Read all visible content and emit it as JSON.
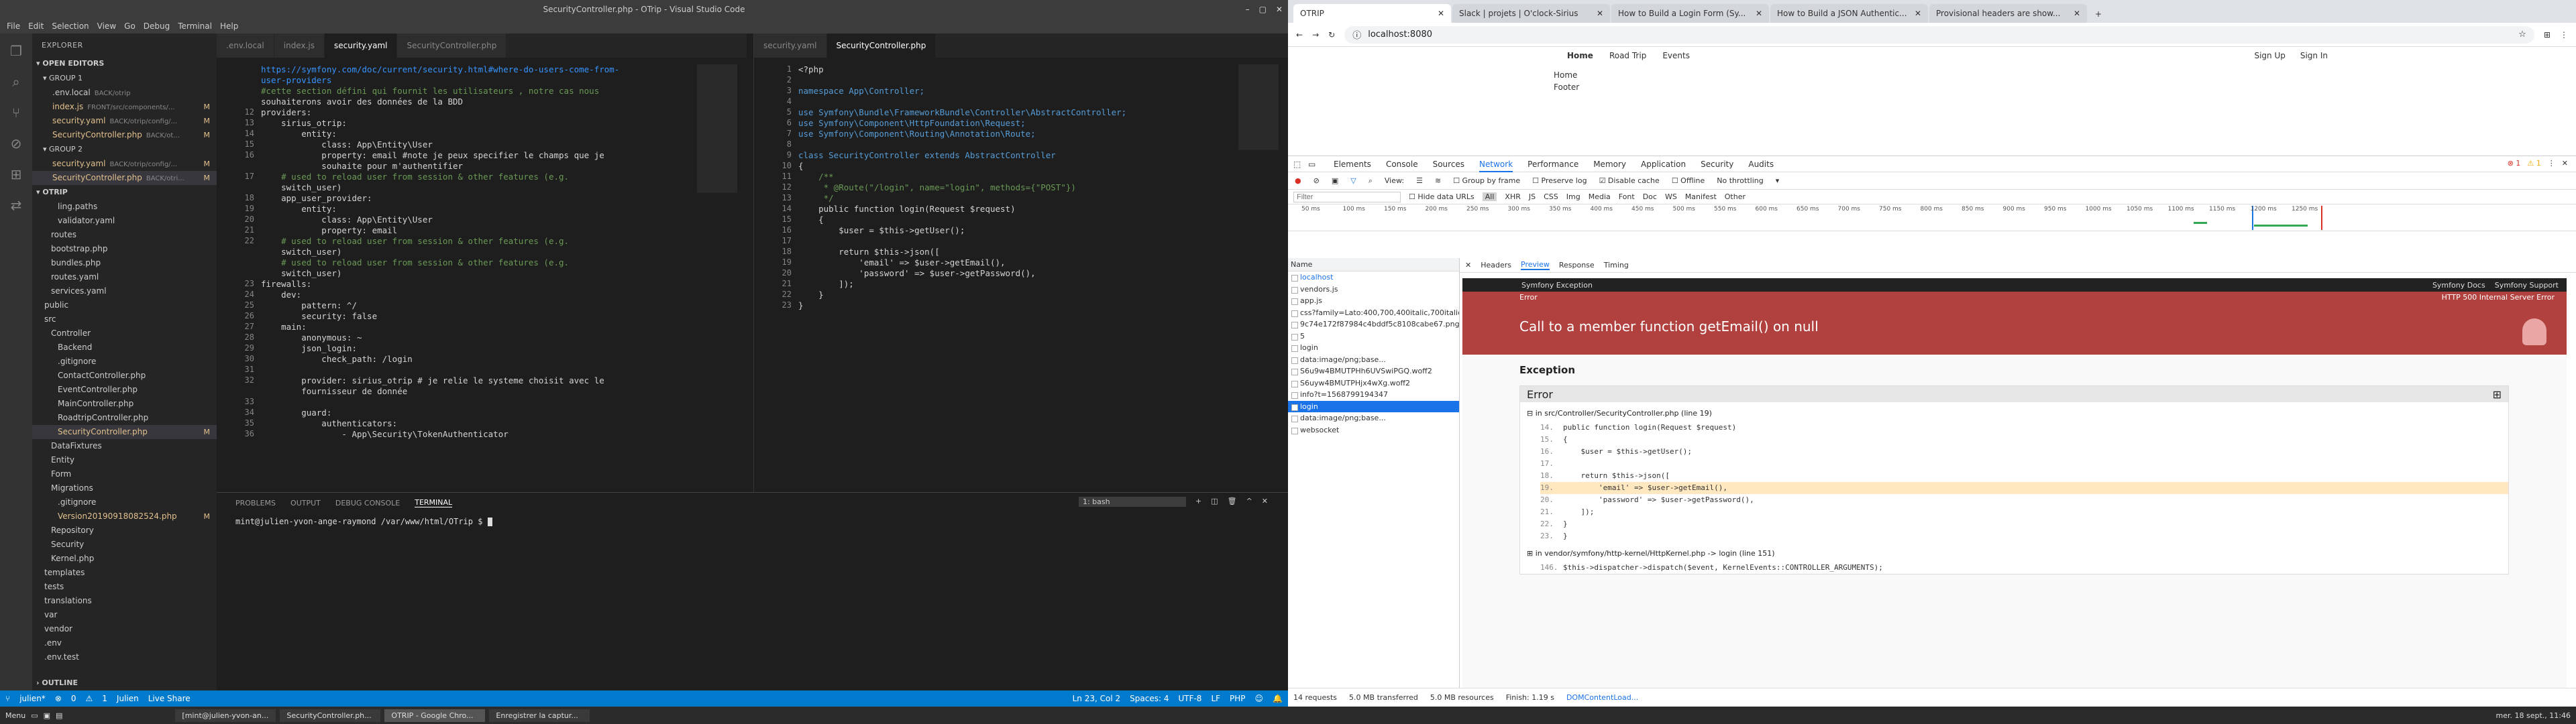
{
  "vscode": {
    "title": "SecurityController.php - OTrip - Visual Studio Code",
    "menu": [
      "File",
      "Edit",
      "Selection",
      "View",
      "Go",
      "Debug",
      "Terminal",
      "Help"
    ],
    "explorer_header": "EXPLORER",
    "open_editors": "OPEN EDITORS",
    "group1": "GROUP 1",
    "group1_items": [
      {
        "name": ".env.local",
        "desc": "BACK/otrip",
        "badge": ""
      },
      {
        "name": "index.js",
        "desc": "FRONT/src/components/...",
        "badge": "M"
      },
      {
        "name": "security.yaml",
        "desc": "BACK/otrip/config/...",
        "badge": "M"
      },
      {
        "name": "SecurityController.php",
        "desc": "BACK/ot...",
        "badge": "M"
      }
    ],
    "group2": "GROUP 2",
    "group2_items": [
      {
        "name": "security.yaml",
        "desc": "BACK/otrip/config/...",
        "badge": "M"
      },
      {
        "name": "SecurityController.php",
        "desc": "BACK/otri...",
        "badge": "M"
      }
    ],
    "project": "OTRIP",
    "tree": [
      {
        "label": "ling.paths",
        "indent": 3,
        "badge": ""
      },
      {
        "label": "validator.yaml",
        "indent": 3,
        "badge": ""
      },
      {
        "label": "routes",
        "indent": 2,
        "badge": ""
      },
      {
        "label": "bootstrap.php",
        "indent": 2,
        "badge": ""
      },
      {
        "label": "bundles.php",
        "indent": 2,
        "badge": ""
      },
      {
        "label": "routes.yaml",
        "indent": 2,
        "badge": ""
      },
      {
        "label": "services.yaml",
        "indent": 2,
        "badge": ""
      },
      {
        "label": "public",
        "indent": 1,
        "badge": ""
      },
      {
        "label": "src",
        "indent": 1,
        "badge": ""
      },
      {
        "label": "Controller",
        "indent": 2,
        "badge": ""
      },
      {
        "label": "Backend",
        "indent": 3,
        "badge": ""
      },
      {
        "label": ".gitignore",
        "indent": 3,
        "badge": ""
      },
      {
        "label": "ContactController.php",
        "indent": 3,
        "badge": ""
      },
      {
        "label": "EventController.php",
        "indent": 3,
        "badge": ""
      },
      {
        "label": "MainController.php",
        "indent": 3,
        "badge": ""
      },
      {
        "label": "RoadtripController.php",
        "indent": 3,
        "badge": ""
      },
      {
        "label": "SecurityController.php",
        "indent": 3,
        "badge": "M"
      },
      {
        "label": "DataFixtures",
        "indent": 2,
        "badge": ""
      },
      {
        "label": "Entity",
        "indent": 2,
        "badge": ""
      },
      {
        "label": "Form",
        "indent": 2,
        "badge": ""
      },
      {
        "label": "Migrations",
        "indent": 2,
        "badge": ""
      },
      {
        "label": ".gitignore",
        "indent": 3,
        "badge": ""
      },
      {
        "label": "Version20190918082524.php",
        "indent": 3,
        "badge": "M"
      },
      {
        "label": "Repository",
        "indent": 2,
        "badge": ""
      },
      {
        "label": "Security",
        "indent": 2,
        "badge": ""
      },
      {
        "label": "Kernel.php",
        "indent": 2,
        "badge": ""
      },
      {
        "label": "templates",
        "indent": 1,
        "badge": ""
      },
      {
        "label": "tests",
        "indent": 1,
        "badge": ""
      },
      {
        "label": "translations",
        "indent": 1,
        "badge": ""
      },
      {
        "label": "var",
        "indent": 1,
        "badge": ""
      },
      {
        "label": "vendor",
        "indent": 1,
        "badge": ""
      },
      {
        "label": ".env",
        "indent": 1,
        "badge": ""
      },
      {
        "label": ".env.test",
        "indent": 1,
        "badge": ""
      }
    ],
    "outline": "OUTLINE",
    "left_tabs": [
      ".env.local",
      "index.js",
      "security.yaml",
      "SecurityController.php"
    ],
    "right_tabs": [
      "security.yaml",
      "SecurityController.php"
    ],
    "left_lines": [
      {
        "n": "",
        "t": "https://symfony.com/doc/current/security.html#where-do-users-come-from-"
      },
      {
        "n": "",
        "t": "user-providers"
      },
      {
        "n": "",
        "t": "#cette section défini qui fournit les utilisateurs , notre cas nous"
      },
      {
        "n": "",
        "t": "souhaiterons avoir des données de la BDD"
      },
      {
        "n": "12",
        "t": "providers:"
      },
      {
        "n": "13",
        "t": "    sirius_otrip:"
      },
      {
        "n": "14",
        "t": "        entity:"
      },
      {
        "n": "15",
        "t": "            class: App\\Entity\\User"
      },
      {
        "n": "16",
        "t": "            property: email #note je peux specifier le champs que je"
      },
      {
        "n": "",
        "t": "            souhaite pour m'authentifier"
      },
      {
        "n": "17",
        "t": "    # used to reload user from session & other features (e.g."
      },
      {
        "n": "",
        "t": "    switch_user)"
      },
      {
        "n": "18",
        "t": "    app_user_provider:"
      },
      {
        "n": "19",
        "t": "        entity:"
      },
      {
        "n": "20",
        "t": "            class: App\\Entity\\User"
      },
      {
        "n": "21",
        "t": "            property: email"
      },
      {
        "n": "22",
        "t": "    # used to reload user from session & other features (e.g."
      },
      {
        "n": "",
        "t": "    switch_user)"
      },
      {
        "n": "",
        "t": "    # used to reload user from session & other features (e.g."
      },
      {
        "n": "",
        "t": "    switch_user)"
      },
      {
        "n": "23",
        "t": "firewalls:"
      },
      {
        "n": "24",
        "t": "    dev:"
      },
      {
        "n": "25",
        "t": "        pattern: ^/"
      },
      {
        "n": "26",
        "t": "        security: false"
      },
      {
        "n": "27",
        "t": "    main:"
      },
      {
        "n": "28",
        "t": "        anonymous: ~"
      },
      {
        "n": "29",
        "t": "        json_login:"
      },
      {
        "n": "30",
        "t": "            check_path: /login"
      },
      {
        "n": "31",
        "t": ""
      },
      {
        "n": "32",
        "t": "        provider: sirius_otrip # je relie le systeme choisit avec le"
      },
      {
        "n": "",
        "t": "        fournisseur de donnée"
      },
      {
        "n": "33",
        "t": ""
      },
      {
        "n": "34",
        "t": "        guard:"
      },
      {
        "n": "35",
        "t": "            authenticators:"
      },
      {
        "n": "36",
        "t": "                - App\\Security\\TokenAuthenticator"
      }
    ],
    "right_lines": [
      {
        "n": "1",
        "t": "<?php"
      },
      {
        "n": "2",
        "t": ""
      },
      {
        "n": "3",
        "t": "namespace App\\Controller;"
      },
      {
        "n": "4",
        "t": ""
      },
      {
        "n": "5",
        "t": "use Symfony\\Bundle\\FrameworkBundle\\Controller\\AbstractController;"
      },
      {
        "n": "6",
        "t": "use Symfony\\Component\\HttpFoundation\\Request;"
      },
      {
        "n": "7",
        "t": "use Symfony\\Component\\Routing\\Annotation\\Route;"
      },
      {
        "n": "8",
        "t": ""
      },
      {
        "n": "9",
        "t": "class SecurityController extends AbstractController"
      },
      {
        "n": "10",
        "t": "{"
      },
      {
        "n": "11",
        "t": "    /**"
      },
      {
        "n": "12",
        "t": "     * @Route(\"/login\", name=\"login\", methods={\"POST\"})"
      },
      {
        "n": "13",
        "t": "     */"
      },
      {
        "n": "14",
        "t": "    public function login(Request $request)"
      },
      {
        "n": "15",
        "t": "    {"
      },
      {
        "n": "16",
        "t": "        $user = $this->getUser();"
      },
      {
        "n": "17",
        "t": ""
      },
      {
        "n": "18",
        "t": "        return $this->json(["
      },
      {
        "n": "19",
        "t": "            'email' => $user->getEmail(),"
      },
      {
        "n": "20",
        "t": "            'password' => $user->getPassword(),"
      },
      {
        "n": "21",
        "t": "        ]);"
      },
      {
        "n": "22",
        "t": "    }"
      },
      {
        "n": "23",
        "t": "}"
      }
    ],
    "panel_tabs": [
      "PROBLEMS",
      "OUTPUT",
      "DEBUG CONSOLE",
      "TERMINAL"
    ],
    "terminal_select": "1: bash",
    "terminal_prompt": "mint@julien-yvon-ange-raymond /var/www/html/OTrip $ ",
    "status_left": [
      "julien*",
      "0",
      "1",
      "Julien",
      "Live Share"
    ],
    "status_right": [
      "Ln 23, Col 2",
      "Spaces: 4",
      "UTF-8",
      "LF",
      "PHP"
    ]
  },
  "chrome": {
    "tabs": [
      "OTRIP",
      "Slack | projets | O'clock-Sirius",
      "How to Build a Login Form (Sy...",
      "How to Build a JSON Authentic...",
      "Provisional headers are show..."
    ],
    "url": "localhost:8080",
    "nav": [
      "Home",
      "Road Trip",
      "Events"
    ],
    "nav_right": [
      "Sign Up",
      "Sign In"
    ],
    "page_items": [
      "Home",
      "Footer"
    ],
    "devtools_tabs": [
      "Elements",
      "Console",
      "Sources",
      "Network",
      "Performance",
      "Memory",
      "Application",
      "Security",
      "Audits"
    ],
    "errors_badge": "1",
    "warnings_badge": "1",
    "toolbar": [
      "View:",
      "Group by frame",
      "Preserve log",
      "Disable cache",
      "Offline",
      "No throttling"
    ],
    "filter_placeholder": "Filter",
    "filter_types": [
      "Hide data URLs",
      "All",
      "XHR",
      "JS",
      "CSS",
      "Img",
      "Media",
      "Font",
      "Doc",
      "WS",
      "Manifest",
      "Other"
    ],
    "timeline_ticks": [
      "50 ms",
      "100 ms",
      "150 ms",
      "200 ms",
      "250 ms",
      "300 ms",
      "350 ms",
      "400 ms",
      "450 ms",
      "500 ms",
      "550 ms",
      "600 ms",
      "650 ms",
      "700 ms",
      "750 ms",
      "800 ms",
      "850 ms",
      "900 ms",
      "950 ms",
      "1000 ms",
      "1050 ms",
      "1100 ms",
      "1150 ms",
      "1200 ms",
      "1250 ms"
    ],
    "requests_header": "Name",
    "requests": [
      "localhost",
      "vendors.js",
      "app.js",
      "css?family=Lato:400,700,400italic,700italic&subset=latin",
      "9c74e172f87984c4bddf5c8108cabe67.png",
      "5",
      "login",
      "data:image/png;base...",
      "S6u9w4BMUTPHh6UVSwiPGQ.woff2",
      "S6uyw4BMUTPHjx4wXg.woff2",
      "info?t=1568799194347",
      "login",
      "data:image/png;base...",
      "websocket"
    ],
    "selected_request": 11,
    "preview_tabs": [
      "Headers",
      "Preview",
      "Response",
      "Timing"
    ],
    "sf_brand": "Symfony Exception",
    "sf_links": [
      "Symfony Docs",
      "Symfony Support"
    ],
    "sf_error_label": "Error",
    "sf_status": "HTTP 500 Internal Server Error",
    "sf_message": "Call to a member function getEmail() on null",
    "sf_exception": "Exception",
    "sf_error_title": "Error",
    "sf_trace1": "in src/Controller/SecurityController.php (line 19)",
    "sf_source": [
      {
        "n": "14.",
        "t": "public function login(Request $request)",
        "hl": false
      },
      {
        "n": "15.",
        "t": "{",
        "hl": false
      },
      {
        "n": "16.",
        "t": "    $user = $this->getUser();",
        "hl": false
      },
      {
        "n": "17.",
        "t": "",
        "hl": false
      },
      {
        "n": "18.",
        "t": "    return $this->json([",
        "hl": false
      },
      {
        "n": "19.",
        "t": "        'email' => $user->getEmail(),",
        "hl": true
      },
      {
        "n": "20.",
        "t": "        'password' => $user->getPassword(),",
        "hl": false
      },
      {
        "n": "21.",
        "t": "    ]);",
        "hl": false
      },
      {
        "n": "22.",
        "t": "}",
        "hl": false
      },
      {
        "n": "23.",
        "t": "}",
        "hl": false
      }
    ],
    "sf_trace2": "in vendor/symfony/http-kernel/HttpKernel.php -> login (line 151)",
    "sf_trace2_line": {
      "n": "146.",
      "t": "$this->dispatcher->dispatch($event, KernelEvents::CONTROLLER_ARGUMENTS);"
    },
    "footer": [
      "14 requests",
      "5.0 MB transferred",
      "5.0 MB resources",
      "Finish: 1.19 s",
      "DOMContentLoad..."
    ]
  },
  "taskbar": {
    "menu": "Menu",
    "windows": [
      "[mint@julien-yvon-an...",
      "SecurityController.ph...",
      "OTRIP - Google Chro...",
      "Enregistrer la captur..."
    ],
    "clock": "mer. 18 sept., 11:46"
  }
}
